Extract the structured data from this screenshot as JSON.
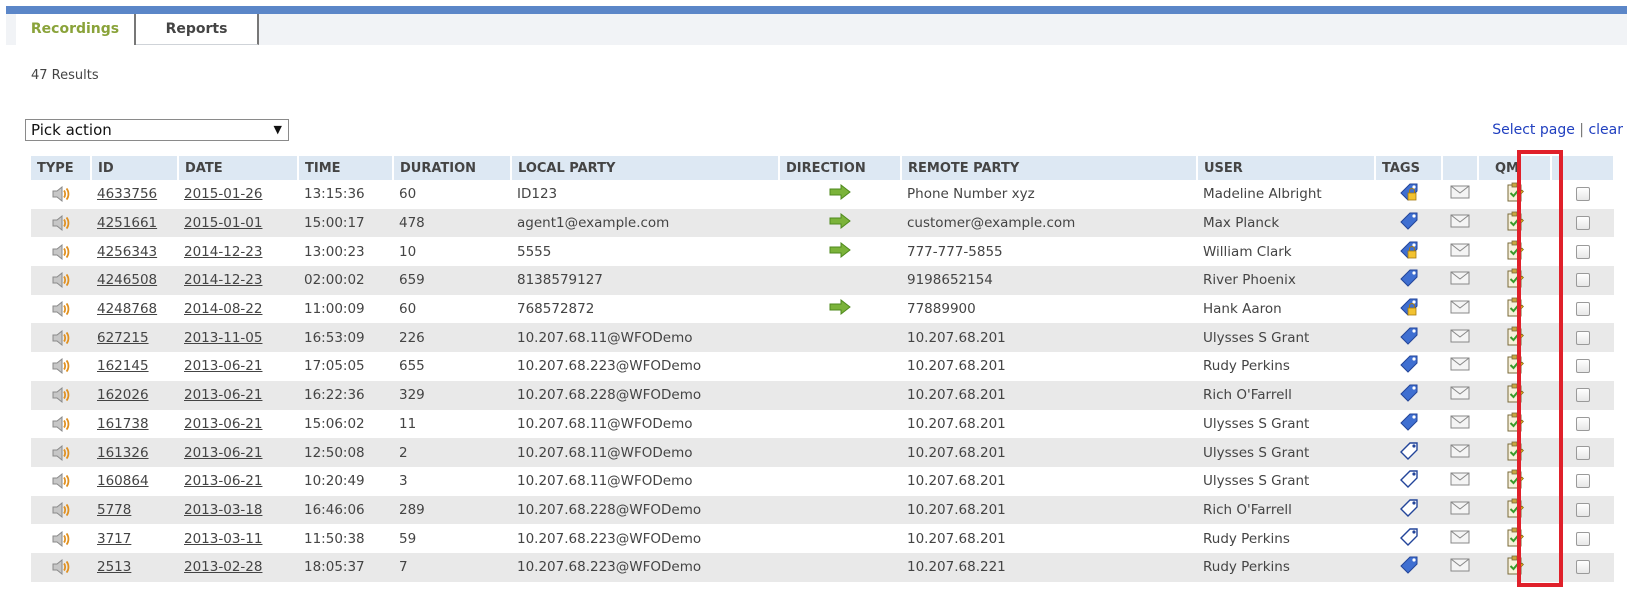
{
  "tabs": [
    {
      "label": "Recordings",
      "active": true
    },
    {
      "label": "Reports",
      "active": false
    }
  ],
  "results_text": "47 Results",
  "action_select": {
    "value": "Pick action"
  },
  "select_links": {
    "select_page": "Select page",
    "separator": "|",
    "clear": "clear"
  },
  "columns": [
    "TYPE",
    "ID",
    "DATE",
    "TIME",
    "DURATION",
    "LOCAL PARTY",
    "DIRECTION",
    "REMOTE PARTY",
    "USER",
    "TAGS",
    "",
    "QM",
    ""
  ],
  "colors": {
    "accent_bar": "#5b86c8",
    "active_tab_text": "#8aa33a",
    "header_bg": "#dde8f3",
    "highlight": "#e0202a",
    "link": "#2140c0"
  },
  "rows": [
    {
      "id": "4633756",
      "date": "2015-01-26",
      "time": "13:15:36",
      "duration": "60",
      "local": "ID123",
      "direction": "arrow-right-icon",
      "remote": "Phone Number xyz",
      "user": "Madeline Albright",
      "tag": "tag-locked-icon"
    },
    {
      "id": "4251661",
      "date": "2015-01-01",
      "time": "15:00:17",
      "duration": "478",
      "local": "agent1@example.com",
      "direction": "arrow-right-icon",
      "remote": "customer@example.com",
      "user": "Max Planck",
      "tag": "tag-filled-icon"
    },
    {
      "id": "4256343",
      "date": "2014-12-23",
      "time": "13:00:23",
      "duration": "10",
      "local": "5555",
      "direction": "arrow-right-icon",
      "remote": "777-777-5855",
      "user": "William Clark",
      "tag": "tag-locked-icon"
    },
    {
      "id": "4246508",
      "date": "2014-12-23",
      "time": "02:00:02",
      "duration": "659",
      "local": "8138579127",
      "direction": "",
      "remote": "9198652154",
      "user": "River Phoenix",
      "tag": "tag-filled-icon"
    },
    {
      "id": "4248768",
      "date": "2014-08-22",
      "time": "11:00:09",
      "duration": "60",
      "local": "768572872",
      "direction": "arrow-right-icon",
      "remote": "77889900",
      "user": "Hank Aaron",
      "tag": "tag-locked-icon"
    },
    {
      "id": "627215",
      "date": "2013-11-05",
      "time": "16:53:09",
      "duration": "226",
      "local": "10.207.68.11@WFODemo",
      "direction": "",
      "remote": "10.207.68.201",
      "user": "Ulysses S Grant",
      "tag": "tag-filled-icon"
    },
    {
      "id": "162145",
      "date": "2013-06-21",
      "time": "17:05:05",
      "duration": "655",
      "local": "10.207.68.223@WFODemo",
      "direction": "",
      "remote": "10.207.68.201",
      "user": "Rudy Perkins",
      "tag": "tag-filled-icon"
    },
    {
      "id": "162026",
      "date": "2013-06-21",
      "time": "16:22:36",
      "duration": "329",
      "local": "10.207.68.228@WFODemo",
      "direction": "",
      "remote": "10.207.68.201",
      "user": "Rich O'Farrell",
      "tag": "tag-filled-icon"
    },
    {
      "id": "161738",
      "date": "2013-06-21",
      "time": "15:06:02",
      "duration": "11",
      "local": "10.207.68.11@WFODemo",
      "direction": "",
      "remote": "10.207.68.201",
      "user": "Ulysses S Grant",
      "tag": "tag-filled-icon"
    },
    {
      "id": "161326",
      "date": "2013-06-21",
      "time": "12:50:08",
      "duration": "2",
      "local": "10.207.68.11@WFODemo",
      "direction": "",
      "remote": "10.207.68.201",
      "user": "Ulysses S Grant",
      "tag": "tag-outline-icon"
    },
    {
      "id": "160864",
      "date": "2013-06-21",
      "time": "10:20:49",
      "duration": "3",
      "local": "10.207.68.11@WFODemo",
      "direction": "",
      "remote": "10.207.68.201",
      "user": "Ulysses S Grant",
      "tag": "tag-outline-icon"
    },
    {
      "id": "5778",
      "date": "2013-03-18",
      "time": "16:46:06",
      "duration": "289",
      "local": "10.207.68.228@WFODemo",
      "direction": "",
      "remote": "10.207.68.201",
      "user": "Rich O'Farrell",
      "tag": "tag-outline-icon"
    },
    {
      "id": "3717",
      "date": "2013-03-11",
      "time": "11:50:38",
      "duration": "59",
      "local": "10.207.68.223@WFODemo",
      "direction": "",
      "remote": "10.207.68.201",
      "user": "Rudy Perkins",
      "tag": "tag-outline-icon"
    },
    {
      "id": "2513",
      "date": "2013-02-28",
      "time": "18:05:37",
      "duration": "7",
      "local": "10.207.68.223@WFODemo",
      "direction": "",
      "remote": "10.207.68.221",
      "user": "Rudy Perkins",
      "tag": "tag-filled-icon"
    }
  ]
}
